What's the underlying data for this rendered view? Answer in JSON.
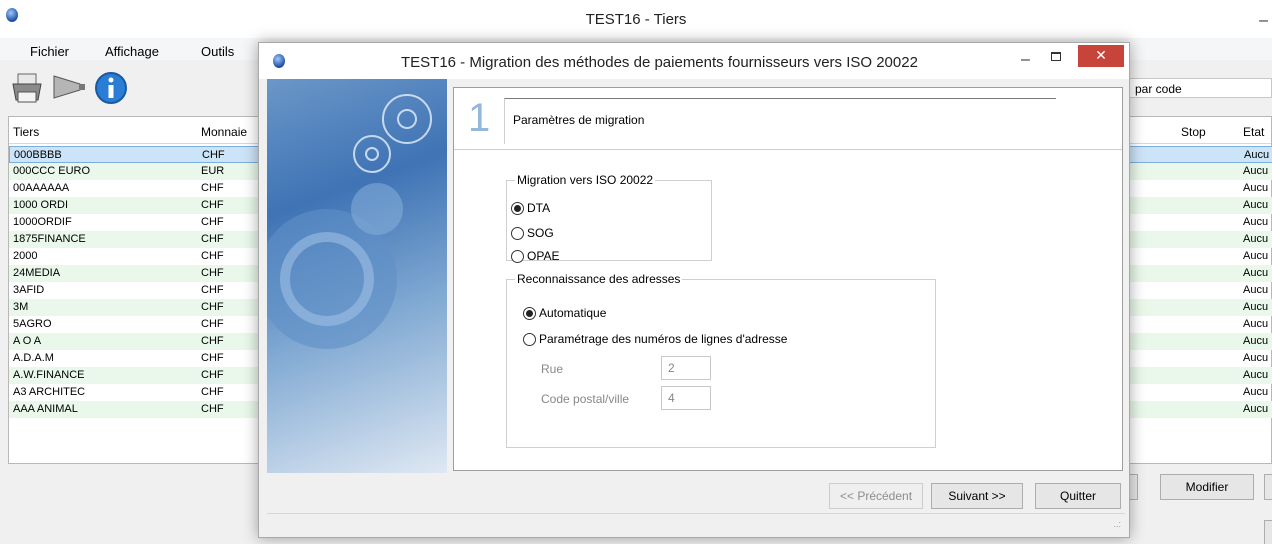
{
  "main": {
    "title": "TEST16 - Tiers",
    "min_glyph": "–",
    "menu": [
      "Fichier",
      "Affichage",
      "Outils"
    ],
    "toolbar_icons": [
      "printer-icon",
      "funnel-filter-icon",
      "info-icon"
    ],
    "sort_field": "par code",
    "columns": {
      "tiers": "Tiers",
      "monnaie": "Monnaie",
      "stop": "Stop",
      "etat": "Etat"
    },
    "rows": [
      {
        "tiers": "000BBBB",
        "monnaie": "CHF",
        "etat": "Aucu"
      },
      {
        "tiers": "000CCC EURO",
        "monnaie": "EUR",
        "etat": "Aucu"
      },
      {
        "tiers": "00AAAAAA",
        "monnaie": "CHF",
        "etat": "Aucu"
      },
      {
        "tiers": "1000 ORDI",
        "monnaie": "CHF",
        "etat": "Aucu"
      },
      {
        "tiers": "1000ORDIF",
        "monnaie": "CHF",
        "etat": "Aucu"
      },
      {
        "tiers": "1875FINANCE",
        "monnaie": "CHF",
        "etat": "Aucu"
      },
      {
        "tiers": "2000",
        "monnaie": "CHF",
        "etat": "Aucu"
      },
      {
        "tiers": "24MEDIA",
        "monnaie": "CHF",
        "etat": "Aucu"
      },
      {
        "tiers": "3AFID",
        "monnaie": "CHF",
        "etat": "Aucu"
      },
      {
        "tiers": "3M",
        "monnaie": "CHF",
        "etat": "Aucu"
      },
      {
        "tiers": "5AGRO",
        "monnaie": "CHF",
        "etat": "Aucu"
      },
      {
        "tiers": "A O A",
        "monnaie": "CHF",
        "etat": "Aucu"
      },
      {
        "tiers": "A.D.A.M",
        "monnaie": "CHF",
        "etat": "Aucu"
      },
      {
        "tiers": "A.W.FINANCE",
        "monnaie": "CHF",
        "etat": "Aucu"
      },
      {
        "tiers": "A3 ARCHITEC",
        "monnaie": "CHF",
        "etat": "Aucu"
      },
      {
        "tiers": "AAA ANIMAL",
        "monnaie": "CHF",
        "etat": "Aucu"
      }
    ],
    "modifier_label": "Modifier"
  },
  "dialog": {
    "title": "TEST16 - Migration des méthodes de paiements fournisseurs vers ISO 20022",
    "min_glyph": "–",
    "close_glyph": "✕",
    "step_number": "1",
    "step_label": "Paramètres de migration",
    "migration_group": "Migration vers ISO 20022",
    "migration_options": [
      "DTA",
      "SOG",
      "OPAE"
    ],
    "migration_selected": "DTA",
    "address_group": "Reconnaissance des adresses",
    "address_options": [
      "Automatique",
      "Paramétrage des numéros de lignes d'adresse"
    ],
    "address_selected": "Automatique",
    "rue_label": "Rue",
    "rue_value": "2",
    "cp_label": "Code postal/ville",
    "cp_value": "4",
    "btn_prev": "<< Précédent",
    "btn_next": "Suivant >>",
    "btn_quit": "Quitter",
    "resize_grip": "..:"
  },
  "colors": {
    "selected_row": "#cce4f7",
    "alt_row": "#e9f8ea",
    "close_button": "#c7443a"
  }
}
